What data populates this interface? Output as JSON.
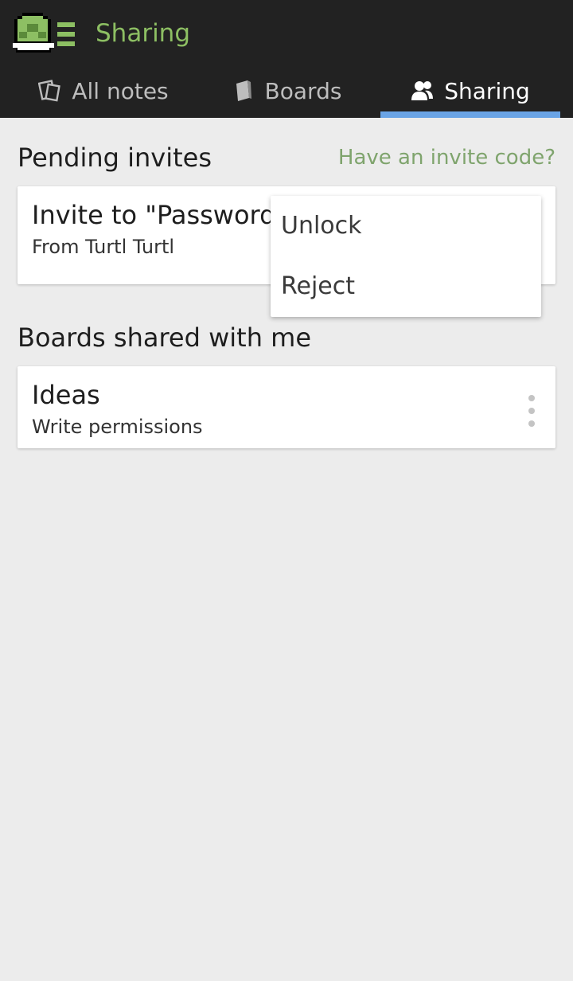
{
  "app": {
    "title": "Sharing",
    "accent": "#8dbf63",
    "tab_indicator_color": "#6aa4e6"
  },
  "tabs": [
    {
      "label": "All notes",
      "icon": "notes-icon",
      "active": false
    },
    {
      "label": "Boards",
      "icon": "book-icon",
      "active": false
    },
    {
      "label": "Sharing",
      "icon": "people-icon",
      "active": true
    }
  ],
  "pending": {
    "title": "Pending invites",
    "invite_code_link": "Have an invite code?",
    "invite": {
      "title": "Invite to \"Passwords\"",
      "from": "From Turtl Turtl"
    }
  },
  "menu": {
    "items": [
      "Unlock",
      "Reject"
    ]
  },
  "shared": {
    "title": "Boards shared with me",
    "boards": [
      {
        "name": "Ideas",
        "permissions": "Write permissions"
      }
    ]
  }
}
